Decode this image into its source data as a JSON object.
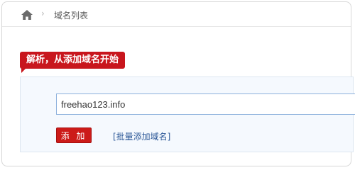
{
  "breadcrumb": {
    "separator": "›",
    "current": "域名列表"
  },
  "hint": {
    "text": "解析，从添加域名开始"
  },
  "form": {
    "domain_value": "freehao123.info",
    "add_label": "添 加",
    "bulk_add_link": "[批量添加域名]"
  },
  "colors": {
    "accent_red": "#c8161d",
    "link_blue": "#2b5797",
    "input_border": "#8cb0dc"
  },
  "icons": {
    "home": "home-icon",
    "separator": "chevron-right-icon"
  }
}
